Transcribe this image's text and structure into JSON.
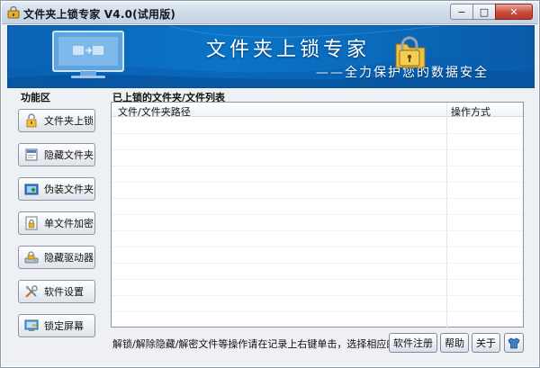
{
  "window": {
    "title": "文件夹上锁专家 V4.0(试用版)",
    "minimize_glyph": "−",
    "maximize_glyph": "□",
    "close_glyph": "✕"
  },
  "banner": {
    "title": "文件夹上锁专家",
    "subtitle": "——全力保护您的数据安全"
  },
  "sidebar": {
    "heading": "功能区",
    "items": [
      {
        "label": "文件夹上锁",
        "icon": "lock-folder-icon"
      },
      {
        "label": "隐藏文件夹",
        "icon": "hide-folder-icon"
      },
      {
        "label": "伪装文件夹",
        "icon": "disguise-folder-icon"
      },
      {
        "label": "单文件加密",
        "icon": "encrypt-file-icon"
      },
      {
        "label": "隐藏驱动器",
        "icon": "hide-drive-icon"
      },
      {
        "label": "软件设置",
        "icon": "settings-tools-icon"
      },
      {
        "label": "锁定屏幕",
        "icon": "lock-screen-icon"
      }
    ]
  },
  "list": {
    "heading": "已上锁的文件夹/文件列表",
    "columns": [
      "文件/文件夹路径",
      "操作方式"
    ],
    "rows": []
  },
  "footer": {
    "hint": "解锁/解除隐藏/解密文件等操作请在记录上右键单击，选择相应的命令。",
    "register_label": "软件注册",
    "help_label": "帮助",
    "about_label": "关于",
    "skin_icon": "shirt-icon"
  },
  "colors": {
    "banner_blue": "#0a74c6",
    "titlebar": "#cdd9e8",
    "close_red": "#c9493a"
  }
}
